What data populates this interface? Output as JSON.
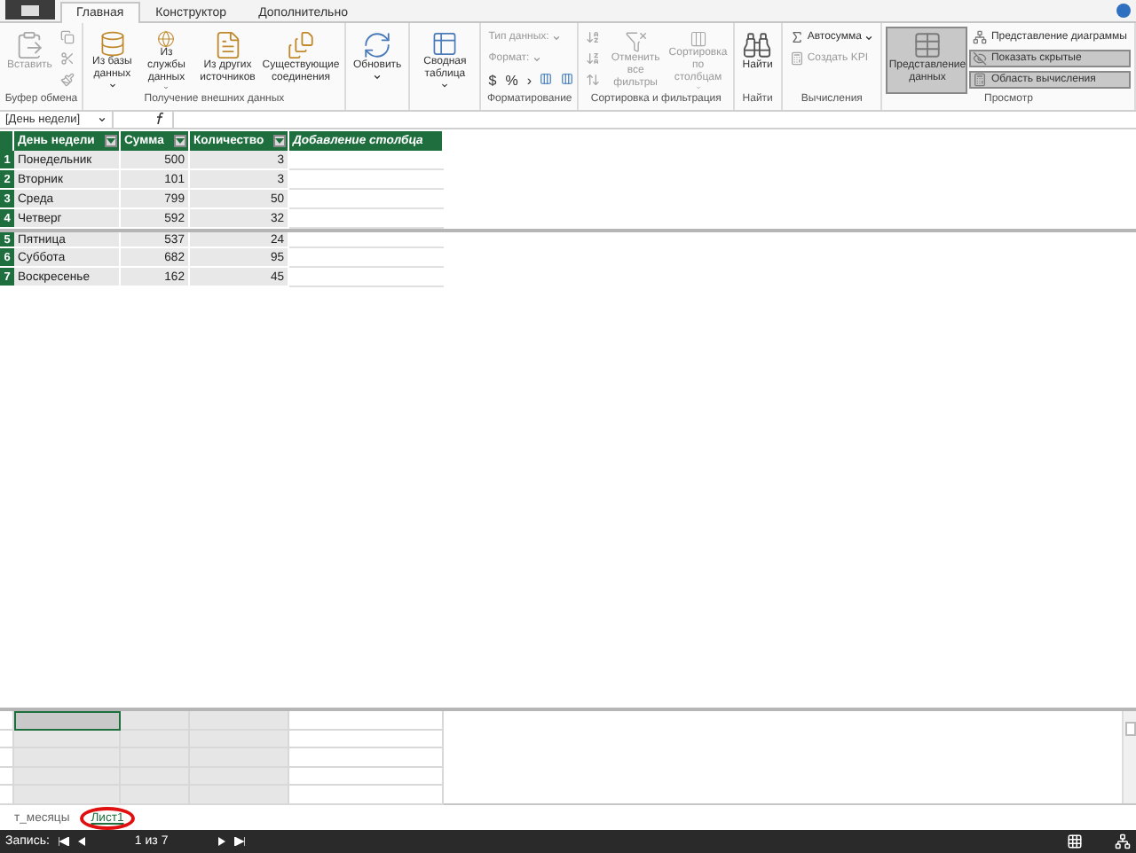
{
  "tabs": [
    {
      "label": "Главная",
      "selected": true
    },
    {
      "label": "Конструктор",
      "selected": false
    },
    {
      "label": "Дополнительно",
      "selected": false
    }
  ],
  "ribbon": [
    {
      "label": "Буфер обмена",
      "items": [
        {
          "kind": "large",
          "label": "Вставить",
          "disabled": true
        },
        {
          "kind": "stack",
          "children": [
            {
              "kind": "icon",
              "disabled": true
            },
            {
              "kind": "icon",
              "disabled": true
            },
            {
              "kind": "icon",
              "disabled": true
            }
          ]
        }
      ]
    },
    {
      "label": "Получение внешних данных",
      "items": [
        {
          "kind": "large",
          "label": "Из базы данных",
          "dropdown": true,
          "disabled": false
        },
        {
          "kind": "large",
          "label": "Из службы данных",
          "dropdown": true,
          "disabled": false
        },
        {
          "kind": "large",
          "label": "Из других источников",
          "disabled": false
        },
        {
          "kind": "large",
          "label": "Существующие соединения",
          "disabled": false
        }
      ]
    },
    {
      "items": [
        {
          "kind": "large",
          "label": "Обновить",
          "dropdown": true,
          "disabled": false
        }
      ]
    },
    {
      "items": [
        {
          "kind": "large",
          "label": "Сводная таблица",
          "dropdown": true,
          "disabled": false
        }
      ]
    },
    {
      "label": "Форматирование",
      "items": [
        {
          "kind": "stack",
          "children": [
            {
              "kind": "dropdown",
              "label": "Тип данных:",
              "disabled": true
            },
            {
              "kind": "dropdown",
              "label": "Формат:",
              "disabled": true
            },
            {
              "kind": "symbols",
              "symbols": [
                "$",
                "%",
                "›"
              ],
              "disabled": false
            }
          ]
        }
      ]
    },
    {
      "label": "Сортировка и фильтрация",
      "items": [
        {
          "kind": "stack",
          "children": [
            {
              "kind": "icon",
              "disabled": true
            },
            {
              "kind": "icon",
              "disabled": true
            },
            {
              "kind": "icon",
              "disabled": true
            }
          ]
        },
        {
          "kind": "large",
          "label": "Отменить все фильтры",
          "disabled": true
        },
        {
          "kind": "large",
          "label": "Сортировка по столбцам",
          "dropdown": true,
          "disabled": true
        }
      ]
    },
    {
      "label": "Найти",
      "items": [
        {
          "kind": "large",
          "label": "Найти",
          "disabled": false
        }
      ]
    },
    {
      "label": "Вычисления",
      "items": [
        {
          "kind": "stack",
          "children": [
            {
              "kind": "small",
              "label": "Автосумма",
              "dropdown": true,
              "disabled": false
            },
            {
              "kind": "small",
              "label": "Создать KPI",
              "disabled": true
            }
          ]
        }
      ]
    },
    {
      "label": "Просмотр",
      "items": [
        {
          "kind": "large",
          "label": "Представление данных",
          "selected": true,
          "disabled": false
        },
        {
          "kind": "stack",
          "children": [
            {
              "kind": "small",
              "label": "Представление диаграммы",
              "selected": false,
              "disabled": false
            },
            {
              "kind": "small",
              "label": "Показать скрытые",
              "selected": true,
              "disabled": false
            },
            {
              "kind": "small",
              "label": "Область вычисления",
              "selected": true,
              "disabled": false
            }
          ]
        }
      ]
    }
  ],
  "name_box": "[День недели]",
  "table": {
    "columns": [
      {
        "label": "День недели",
        "kind": "data"
      },
      {
        "label": "Сумма",
        "kind": "data"
      },
      {
        "label": "Количество",
        "kind": "data"
      },
      {
        "label": "Добавление столбца",
        "kind": "add"
      }
    ],
    "rows": [
      {
        "num": "1",
        "cells": [
          "Понедельник",
          "500",
          "3"
        ]
      },
      {
        "num": "2",
        "cells": [
          "Вторник",
          "101",
          "3"
        ]
      },
      {
        "num": "3",
        "cells": [
          "Среда",
          "799",
          "50"
        ]
      },
      {
        "num": "4",
        "cells": [
          "Четверг",
          "592",
          "32"
        ]
      },
      {
        "num": "5",
        "cells": [
          "Пятница",
          "537",
          "24"
        ]
      },
      {
        "num": "6",
        "cells": [
          "Суббота",
          "682",
          "95"
        ]
      },
      {
        "num": "7",
        "cells": [
          "Воскресенье",
          "162",
          "45"
        ]
      }
    ]
  },
  "sheets": [
    {
      "label": "т_месяцы",
      "selected": false
    },
    {
      "label": "Лист1",
      "selected": true,
      "circled": true
    }
  ],
  "status": {
    "label": "Запись:",
    "position": "1 из 7"
  }
}
